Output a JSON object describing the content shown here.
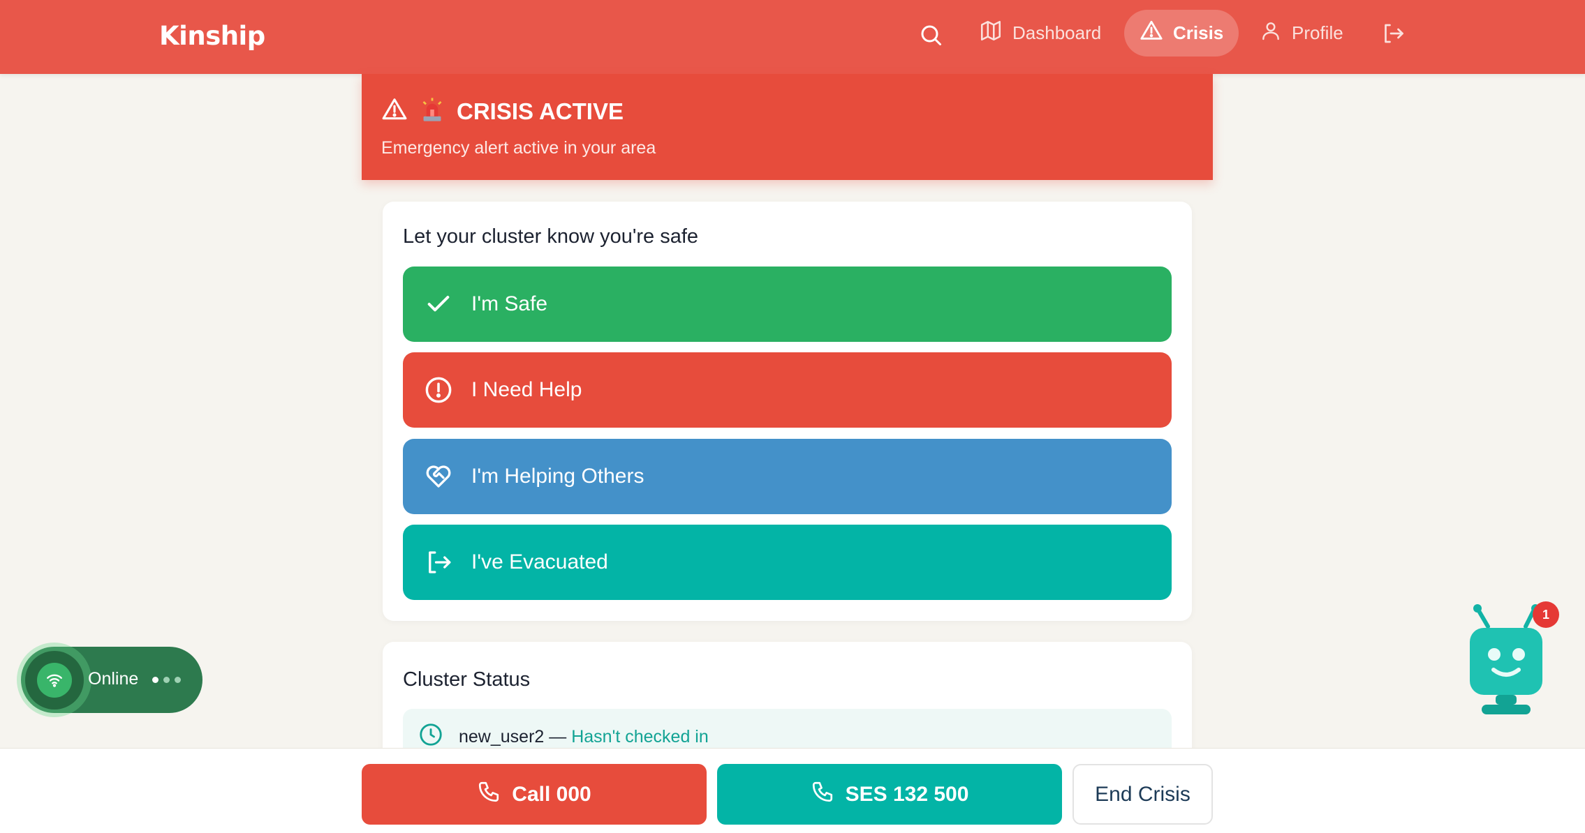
{
  "app": {
    "brand": "Kinship"
  },
  "nav": {
    "dashboard": "Dashboard",
    "crisis": "Crisis",
    "profile": "Profile"
  },
  "banner": {
    "title": "CRISIS ACTIVE",
    "subtitle": "Emergency alert active in your area",
    "icons": [
      "warning-triangle-icon",
      "siren-icon"
    ]
  },
  "safety": {
    "title": "Let your cluster know you're safe",
    "options": [
      {
        "label": "I'm Safe",
        "icon": "check-icon",
        "color": "#2ab062"
      },
      {
        "label": "I Need Help",
        "icon": "alert-circle-icon",
        "color": "#e74c3c"
      },
      {
        "label": "I'm Helping Others",
        "icon": "heart-handshake-icon",
        "color": "#4491c9"
      },
      {
        "label": "I've Evacuated",
        "icon": "exit-icon",
        "color": "#03b4a6"
      }
    ]
  },
  "cluster": {
    "title": "Cluster Status",
    "members": [
      {
        "name": "new_user2",
        "separator": " — ",
        "status": "Hasn't checked in",
        "icon": "clock-icon"
      }
    ]
  },
  "actions": {
    "call": "Call 000",
    "ses": "SES 132 500",
    "end": "End Crisis"
  },
  "connection": {
    "label": "Online"
  },
  "assistant": {
    "badge": "1"
  },
  "colors": {
    "header": "#e8574a",
    "crisis": "#e74c3c",
    "teal": "#03b4a6",
    "green": "#2ab062",
    "blue": "#4491c9"
  }
}
